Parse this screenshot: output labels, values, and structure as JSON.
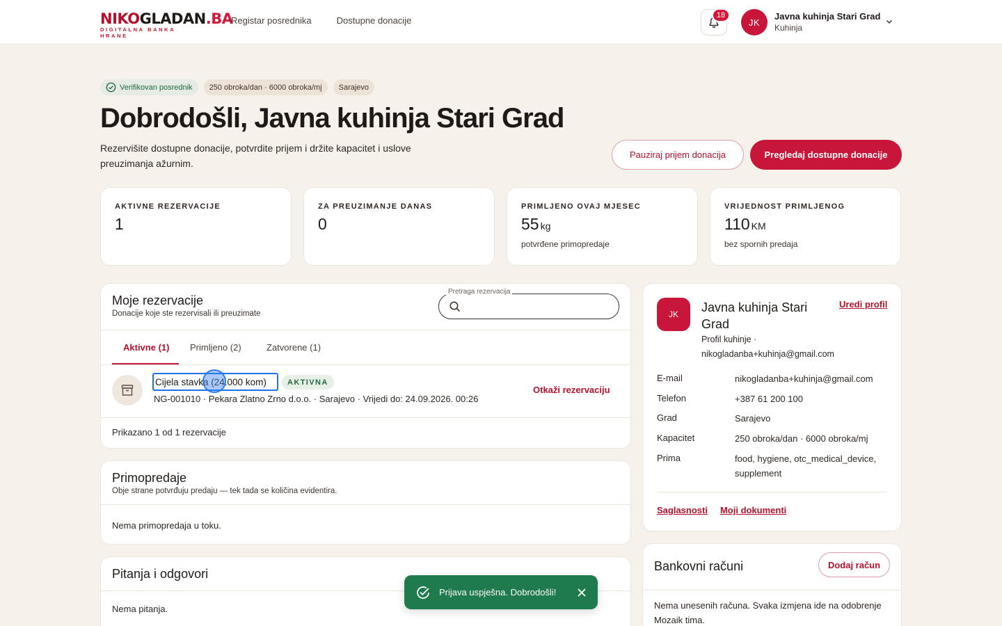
{
  "brand": {
    "logo_part1": "NIKO",
    "logo_part2": "GLADAN",
    "logo_part3": ".BA",
    "tagline": "DIGITALNA BANKA HRANE"
  },
  "nav": {
    "items": [
      "Registar posrednika",
      "Dostupne donacije"
    ]
  },
  "notifications": {
    "count": "18"
  },
  "user": {
    "initials": "JK",
    "name": "Javna kuhinja Stari Grad",
    "role": "Kuhinja"
  },
  "chips": {
    "verified": "Verifikovan posrednik",
    "capacity": "250 obroka/dan · 6000 obroka/mj",
    "city": "Sarajevo"
  },
  "hero": {
    "title": "Dobrodošli, Javna kuhinja Stari Grad",
    "subtitle": "Rezervišite dostupne donacije, potvrdite prijem i držite kapacitet i uslove preuzimanja ažurnim.",
    "pause_button": "Pauziraj prijem donacija",
    "browse_button": "Pregledaj dostupne donacije"
  },
  "stats": [
    {
      "label": "AKTIVNE REZERVACIJE",
      "value": "1",
      "unit": "",
      "note": ""
    },
    {
      "label": "ZA PREUZIMANJE DANAS",
      "value": "0",
      "unit": "",
      "note": ""
    },
    {
      "label": "PRIMLJENO OVAJ MJESEC",
      "value": "55",
      "unit": "kg",
      "note": "potvrđene primopredaje"
    },
    {
      "label": "VRIJEDNOST PRIMLJENOG",
      "value": "110",
      "unit": "KM",
      "note": "bez spornih predaja"
    }
  ],
  "reservations": {
    "title": "Moje rezervacije",
    "subtitle": "Donacije koje ste rezervisali ili preuzimate",
    "search_label": "Pretraga rezervacija",
    "search_value": "",
    "tabs": [
      "Aktivne (1)",
      "Primljeno (2)",
      "Zatvorene (1)"
    ],
    "item": {
      "title": "Cijela stavka (24.000 kom)",
      "badge": "AKTIVNA",
      "meta": "NG-001010 · Pekara Zlatno Zrno d.o.o. · Sarajevo · Vrijedi do: 24.09.2026. 00:26",
      "cancel": "Otkaži rezervaciju"
    },
    "footer": "Prikazano 1 od 1 rezervacije"
  },
  "handovers": {
    "title": "Primopredaje",
    "subtitle": "Obje strane potvrđuju predaju — tek tada se količina evidentira.",
    "empty": "Nema primopredaja u toku."
  },
  "qa": {
    "title": "Pitanja i odgovori",
    "empty": "Nema pitanja."
  },
  "profile": {
    "initials": "JK",
    "name": "Javna kuhinja Stari Grad",
    "edit": "Uredi profil",
    "subtitle": "Profil kuhinje · nikogladanba+kuhinja@gmail.com",
    "fields": [
      {
        "key": "E-mail",
        "value": "nikogladanba+kuhinja@gmail.com"
      },
      {
        "key": "Telefon",
        "value": "+387 61 200 100"
      },
      {
        "key": "Grad",
        "value": "Sarajevo"
      },
      {
        "key": "Kapacitet",
        "value": "250 obroka/dan · 6000 obroka/mj"
      },
      {
        "key": "Prima",
        "value": "food, hygiene, otc_medical_device, supplement"
      }
    ],
    "links": [
      "Saglasnosti",
      "Moji dokumenti"
    ]
  },
  "bank": {
    "title": "Bankovni računi",
    "add_button": "Dodaj račun",
    "empty": "Nema unesenih računa. Svaka izmjena ide na odobrenje Mozaik tima."
  },
  "toast": {
    "message": "Prijava uspješna. Dobrodošli!"
  },
  "colors": {
    "brand": "#c8163a",
    "success": "#1f7a4d",
    "background": "#f6f1ea"
  }
}
